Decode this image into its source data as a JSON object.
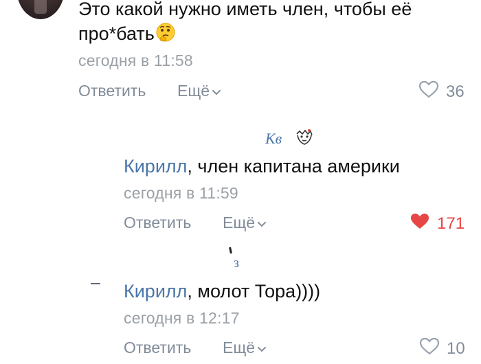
{
  "colors": {
    "text": "#111111",
    "secondary": "#818c99",
    "link": "#4a76a8",
    "like_active": "#e64646"
  },
  "comments": [
    {
      "text_line1": "Это какой нужно иметь член, чтобы её",
      "text_line2": "про*бать",
      "emoji": "🤔",
      "emoji_icon": "thinking-face-icon",
      "timestamp": "сегодня в 11:58",
      "reply_label": "Ответить",
      "more_label": "Ещё",
      "likes": "36",
      "liked": false
    },
    {
      "author": "Кирилл",
      "text": ", член капитана америки",
      "timestamp": "сегодня в 11:59",
      "reply_label": "Ответить",
      "more_label": "Ещё",
      "likes": "171",
      "liked": true,
      "avatar_scribble": "Кв"
    },
    {
      "author": "Кирилл",
      "text": ", молот Тора))))",
      "timestamp": "сегодня в 12:17",
      "reply_label": "Ответить",
      "more_label": "Ещё",
      "likes": "10",
      "liked": false,
      "avatar_scribble": "з"
    }
  ]
}
